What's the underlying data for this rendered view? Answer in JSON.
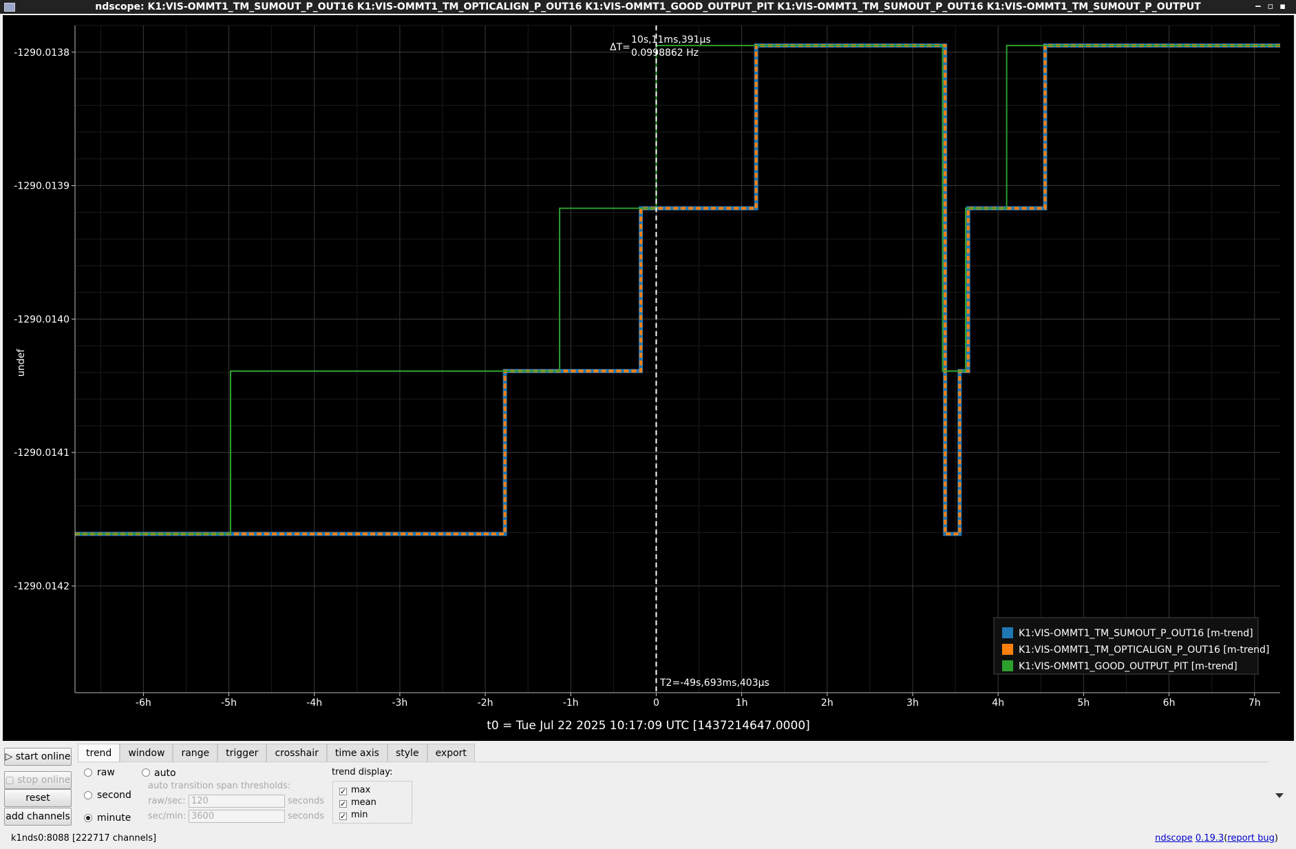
{
  "window": {
    "title": "ndscope: K1:VIS-OMMT1_TM_SUMOUT_P_OUT16 K1:VIS-OMMT1_TM_OPTICALIGN_P_OUT16 K1:VIS-OMMT1_GOOD_OUTPUT_PIT K1:VIS-OMMT1_TM_SUMOUT_P_OUT16 K1:VIS-OMMT1_TM_SUMOUT_P_OUTPUT"
  },
  "plot": {
    "ylabel": "undef",
    "cursor_delta": "ΔT=",
    "cursor_delta_time": "10s,11ms,391μs",
    "cursor_delta_freq": "0.0998862 Hz",
    "cursor_t2": "T2=-49s,693ms,403μs",
    "t0": "t0 = Tue Jul 22 2025 10:17:09 UTC [1437214647.0000]"
  },
  "chart_data": {
    "type": "line",
    "xlabel": "",
    "ylabel": "undef",
    "x_unit": "hours relative to t0",
    "xlim": [
      -6.8,
      7.3
    ],
    "ylim": [
      -1290.01428,
      -1290.01378
    ],
    "x_ticks": [
      {
        "value": -6,
        "label": "-6h"
      },
      {
        "value": -5,
        "label": "-5h"
      },
      {
        "value": -4,
        "label": "-4h"
      },
      {
        "value": -3,
        "label": "-3h"
      },
      {
        "value": -2,
        "label": "-2h"
      },
      {
        "value": -1,
        "label": "-1h"
      },
      {
        "value": 0,
        "label": "0"
      },
      {
        "value": 1,
        "label": "1h"
      },
      {
        "value": 2,
        "label": "2h"
      },
      {
        "value": 3,
        "label": "3h"
      },
      {
        "value": 4,
        "label": "4h"
      },
      {
        "value": 5,
        "label": "5h"
      },
      {
        "value": 6,
        "label": "6h"
      },
      {
        "value": 7,
        "label": "7h"
      }
    ],
    "y_ticks": [
      {
        "value": -1290.0138,
        "label": "-1290.0138"
      },
      {
        "value": -1290.0139,
        "label": "-1290.0139"
      },
      {
        "value": -1290.014,
        "label": "-1290.0140"
      },
      {
        "value": -1290.0141,
        "label": "-1290.0141"
      },
      {
        "value": -1290.0142,
        "label": "-1290.0142"
      }
    ],
    "grid": true,
    "legend_position": "bottom-right",
    "cursor_x": 0,
    "series": [
      {
        "name": "K1:VIS-OMMT1_TM_SUMOUT_P_OUT16 [m-trend]",
        "color": "#1f77b4",
        "points": [
          [
            -6.8,
            -1290.014161
          ],
          [
            -1.77,
            -1290.014161
          ],
          [
            -1.77,
            -1290.014039
          ],
          [
            -0.18,
            -1290.014039
          ],
          [
            -0.18,
            -1290.013917
          ],
          [
            1.17,
            -1290.013917
          ],
          [
            1.17,
            -1290.013795
          ],
          [
            3.38,
            -1290.013795
          ],
          [
            3.38,
            -1290.014161
          ],
          [
            3.55,
            -1290.014161
          ],
          [
            3.55,
            -1290.014039
          ],
          [
            3.65,
            -1290.014039
          ],
          [
            3.65,
            -1290.013917
          ],
          [
            4.55,
            -1290.013917
          ],
          [
            4.55,
            -1290.013795
          ],
          [
            7.3,
            -1290.013795
          ]
        ]
      },
      {
        "name": "K1:VIS-OMMT1_TM_OPTICALIGN_P_OUT16 [m-trend]",
        "color": "#ff7f0e",
        "points": [
          [
            -6.8,
            -1290.014161
          ],
          [
            -1.77,
            -1290.014161
          ],
          [
            -1.77,
            -1290.014039
          ],
          [
            -0.18,
            -1290.014039
          ],
          [
            -0.18,
            -1290.013917
          ],
          [
            1.17,
            -1290.013917
          ],
          [
            1.17,
            -1290.013795
          ],
          [
            3.38,
            -1290.013795
          ],
          [
            3.38,
            -1290.014161
          ],
          [
            3.55,
            -1290.014161
          ],
          [
            3.55,
            -1290.014039
          ],
          [
            3.65,
            -1290.014039
          ],
          [
            3.65,
            -1290.013917
          ],
          [
            4.55,
            -1290.013917
          ],
          [
            4.55,
            -1290.013795
          ],
          [
            7.3,
            -1290.013795
          ]
        ]
      },
      {
        "name": "K1:VIS-OMMT1_GOOD_OUTPUT_PIT [m-trend]",
        "color": "#2ca02c",
        "points": [
          [
            -6.8,
            -1290.014161
          ],
          [
            -4.98,
            -1290.014161
          ],
          [
            -4.98,
            -1290.014039
          ],
          [
            -1.13,
            -1290.014039
          ],
          [
            -1.13,
            -1290.013917
          ],
          [
            0,
            -1290.013917
          ],
          [
            0,
            -1290.013795
          ],
          [
            3.35,
            -1290.013795
          ],
          [
            3.35,
            -1290.014039
          ],
          [
            3.62,
            -1290.014039
          ],
          [
            3.62,
            -1290.013917
          ],
          [
            4.1,
            -1290.013917
          ],
          [
            4.1,
            -1290.013795
          ],
          [
            7.3,
            -1290.013795
          ]
        ]
      }
    ]
  },
  "controls": {
    "start_online": "▷ start online",
    "stop_online": "▢ stop online",
    "reset": "reset",
    "add_channels": "add channels",
    "tabs": [
      "trend",
      "window",
      "range",
      "trigger",
      "crosshair",
      "time axis",
      "style",
      "export"
    ],
    "active_tab": "trend",
    "trend": {
      "raw": "raw",
      "second": "second",
      "minute": "minute",
      "auto": "auto",
      "selected": "minute",
      "thresholds_label": "auto transition span thresholds:",
      "raw_sec_label": "raw/sec:",
      "raw_sec_value": "120",
      "sec_min_label": "sec/min:",
      "sec_min_value": "3600",
      "seconds_unit": "seconds",
      "display_label": "trend display:",
      "max": "max",
      "mean": "mean",
      "min": "min",
      "check": "✓"
    }
  },
  "status": {
    "server": "k1nds0:8088",
    "channels": "[222717 channels]",
    "app": "ndscope",
    "version": "0.19.3",
    "report_bug": "report bug",
    "open_paren": "(",
    "close_paren": ")"
  }
}
